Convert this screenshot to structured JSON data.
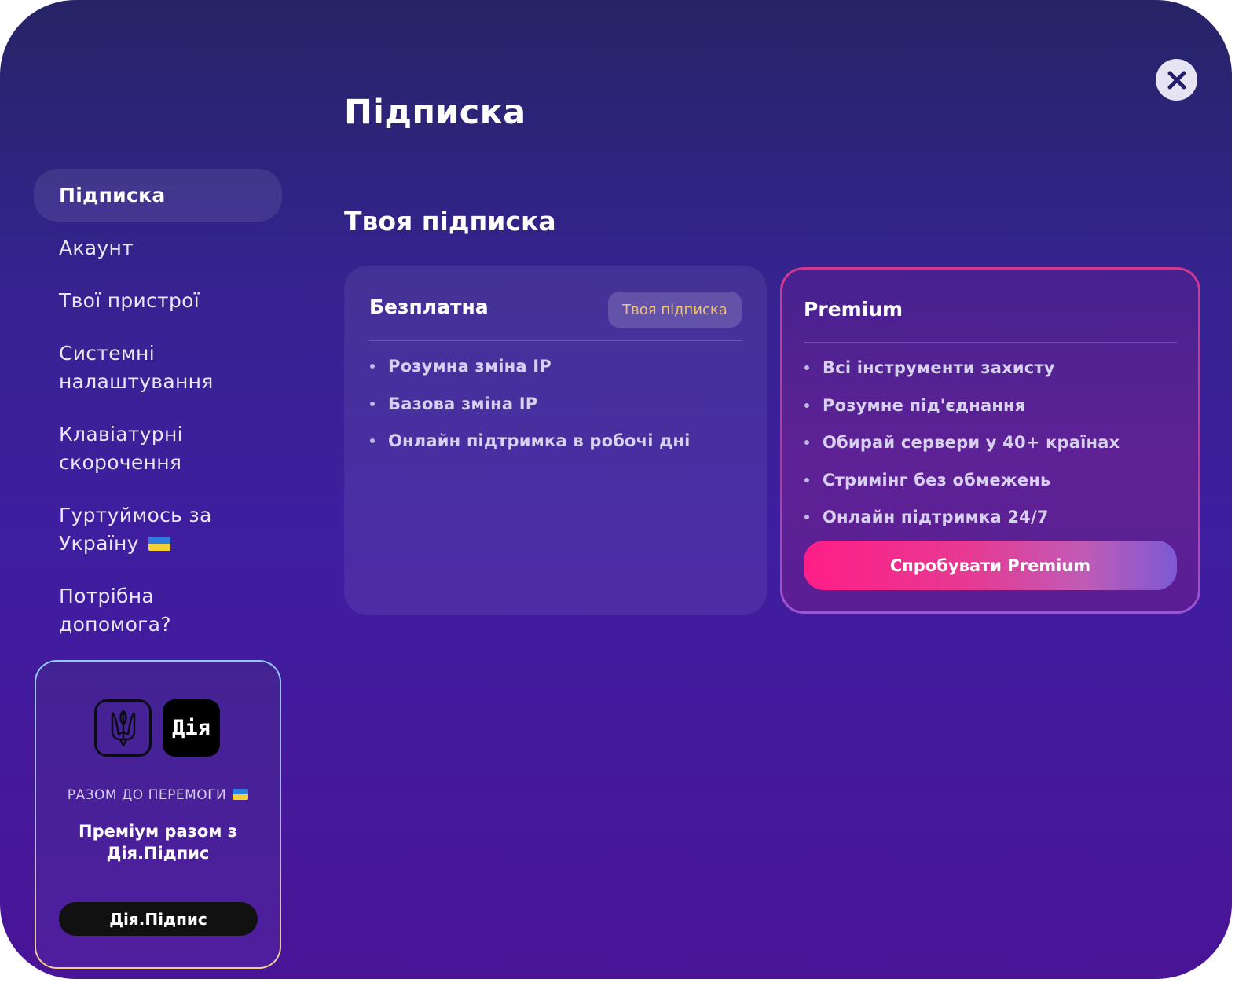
{
  "page": {
    "title": "Підписка",
    "section_title": "Твоя підписка"
  },
  "nav": {
    "items": [
      {
        "label": "Підписка",
        "active": true
      },
      {
        "label": "Акаунт"
      },
      {
        "label": "Твої пристрої"
      },
      {
        "label": "Системні\nналаштування"
      },
      {
        "label": "Клавіатурні\nскорочення"
      },
      {
        "label": "Гуртуймось за\nУкраїну"
      },
      {
        "label": "Потрібна\nдопомога?"
      }
    ]
  },
  "promo": {
    "logo_text": "Дія",
    "eyebrow": "РАЗОМ ДО ПЕРЕМОГИ",
    "title": "Преміум разом з\nДія.Підпис",
    "button_label": "Дія.Підпис"
  },
  "plans": {
    "free": {
      "name": "Безплатна",
      "badge": "Твоя підписка",
      "features": [
        "Розумна зміна IP",
        "Базова зміна IP",
        "Онлайн підтримка в робочі дні"
      ]
    },
    "premium": {
      "name": "Premium",
      "features": [
        "Всі інструменти захисту",
        "Розумне під'єднання",
        "Обирай сервери у 40+ країнах",
        "Стримінг без обмежень",
        "Онлайн підтримка 24/7"
      ],
      "button_label": "Спробувати Premium"
    }
  },
  "icons": {
    "close": "close-icon",
    "flag": "ukraine-flag-icon",
    "trident": "trident-icon"
  },
  "colors": {
    "accent_pink": "#ff1e86",
    "badge_text": "#f1c36a",
    "background_top": "#262466",
    "background_bottom": "#4a1497"
  }
}
